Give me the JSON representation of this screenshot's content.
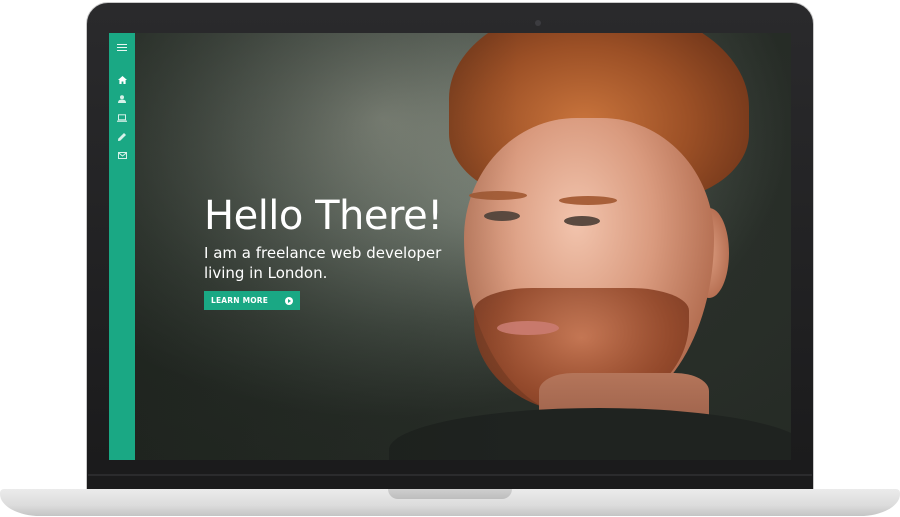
{
  "hero": {
    "title": "Hello There!",
    "subtitle": "I am a freelance web developer living in London.",
    "cta_label": "LEARN MORE"
  },
  "sidebar": {
    "menu_icon": "hamburger-menu-icon",
    "items": [
      {
        "icon": "home-icon"
      },
      {
        "icon": "user-icon"
      },
      {
        "icon": "laptop-icon"
      },
      {
        "icon": "pencil-icon"
      },
      {
        "icon": "envelope-icon"
      }
    ]
  },
  "colors": {
    "accent": "#1aa884",
    "text": "#ffffff",
    "laptop_bezel": "#1b1b1c",
    "laptop_base": "#e2e2e2"
  }
}
